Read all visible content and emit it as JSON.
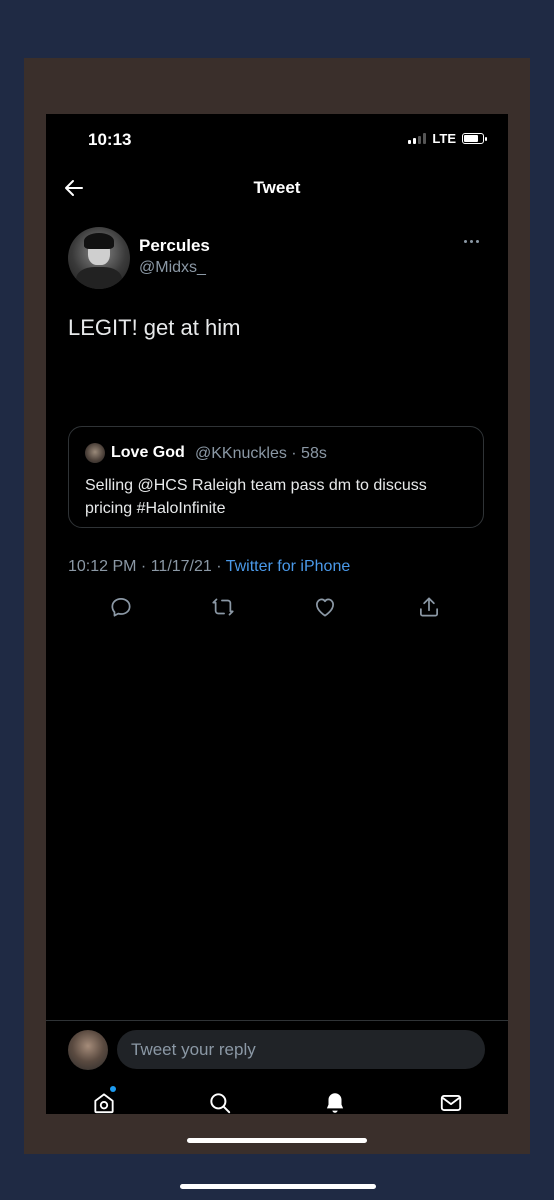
{
  "status_bar": {
    "time": "10:13",
    "network": "LTE"
  },
  "header": {
    "title": "Tweet",
    "back_icon": "arrow-left-icon"
  },
  "tweet": {
    "author_name": "Percules",
    "author_handle": "@Midxs_",
    "text": "LEGIT! get at him",
    "timestamp": "10:12 PM · 11/17/21 · ",
    "source": "Twitter for iPhone"
  },
  "quoted_tweet": {
    "author_name": "Love God",
    "meta": "@KKnuckles · 58s",
    "text": "Selling @HCS Raleigh team pass dm to discuss pricing #HaloInfinite"
  },
  "actions": [
    "reply-icon",
    "retweet-icon",
    "like-icon",
    "share-icon"
  ],
  "reply": {
    "placeholder": "Tweet your reply"
  },
  "tab_bar": [
    "home-icon",
    "search-icon",
    "notifications-icon",
    "messages-icon"
  ],
  "colors": {
    "background": "#000000",
    "accent": "#1d9bf0",
    "link": "#4a99e9",
    "muted": "#8b98a5"
  }
}
